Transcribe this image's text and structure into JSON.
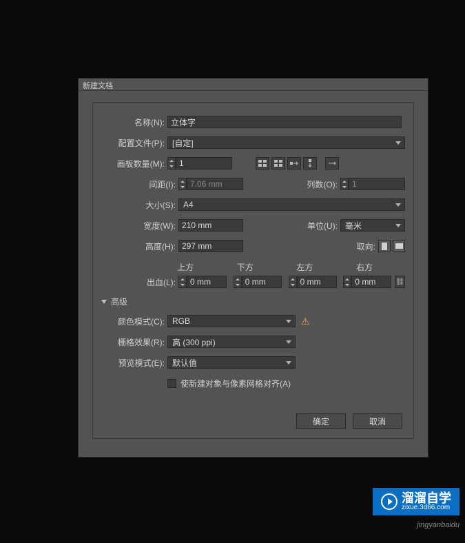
{
  "dialog": {
    "title": "新建文档"
  },
  "name": {
    "label": "名称(N):",
    "value": "立体字"
  },
  "profile": {
    "label": "配置文件(P):",
    "value": "[自定]"
  },
  "artboards": {
    "label": "画板数量(M):",
    "value": "1"
  },
  "spacing": {
    "label": "间距(I):",
    "value": "7.06 mm"
  },
  "columns": {
    "label": "列数(O):",
    "value": "1"
  },
  "size": {
    "label": "大小(S):",
    "value": "A4"
  },
  "width": {
    "label": "宽度(W):",
    "value": "210 mm"
  },
  "units": {
    "label": "单位(U):",
    "value": "毫米"
  },
  "height": {
    "label": "高度(H):",
    "value": "297 mm"
  },
  "orient": {
    "label": "取向:"
  },
  "bleed": {
    "label": "出血(L):",
    "top": {
      "label": "上方",
      "value": "0 mm"
    },
    "bottom": {
      "label": "下方",
      "value": "0 mm"
    },
    "left": {
      "label": "左方",
      "value": "0 mm"
    },
    "right": {
      "label": "右方",
      "value": "0 mm"
    }
  },
  "advanced": {
    "label": "高级"
  },
  "colorMode": {
    "label": "颜色模式(C):",
    "value": "RGB"
  },
  "raster": {
    "label": "栅格效果(R):",
    "value": "高 (300 ppi)"
  },
  "preview": {
    "label": "预览模式(E):",
    "value": "默认值"
  },
  "gridAlign": {
    "label": "使新建对象与像素网格对齐(A)"
  },
  "buttons": {
    "ok": "确定",
    "cancel": "取消"
  },
  "watermark": {
    "brand": "溜溜自学",
    "url": "zixue.3d66.com",
    "sub": "jingyanbaidu"
  }
}
